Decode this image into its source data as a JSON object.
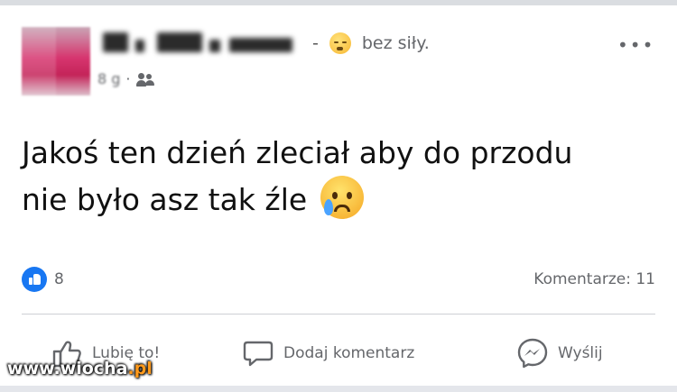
{
  "post": {
    "feeling_text": "bez siły.",
    "feeling_dash": "-",
    "feeling_icon": "exhausted-face-icon",
    "time": "8 g",
    "audience_icon": "friends-icon",
    "more_label": "•••",
    "text_line1": "Jakoś ten dzień zleciał aby do przodu",
    "text_line2": "nie było asz tak źle",
    "text_emoji_icon": "crying-face-icon"
  },
  "stats": {
    "likes_count": "8",
    "comments_label": "Komentarze: 11"
  },
  "actions": {
    "like_label": "Lubię to!",
    "comment_label": "Dodaj komentarz",
    "send_label": "Wyślij"
  },
  "watermark": {
    "text_main": "www.wiocha",
    "text_accent": ".pl"
  },
  "colors": {
    "brand_blue": "#1877f2",
    "secondary_text": "#65676b",
    "divider": "#ced0d4"
  }
}
